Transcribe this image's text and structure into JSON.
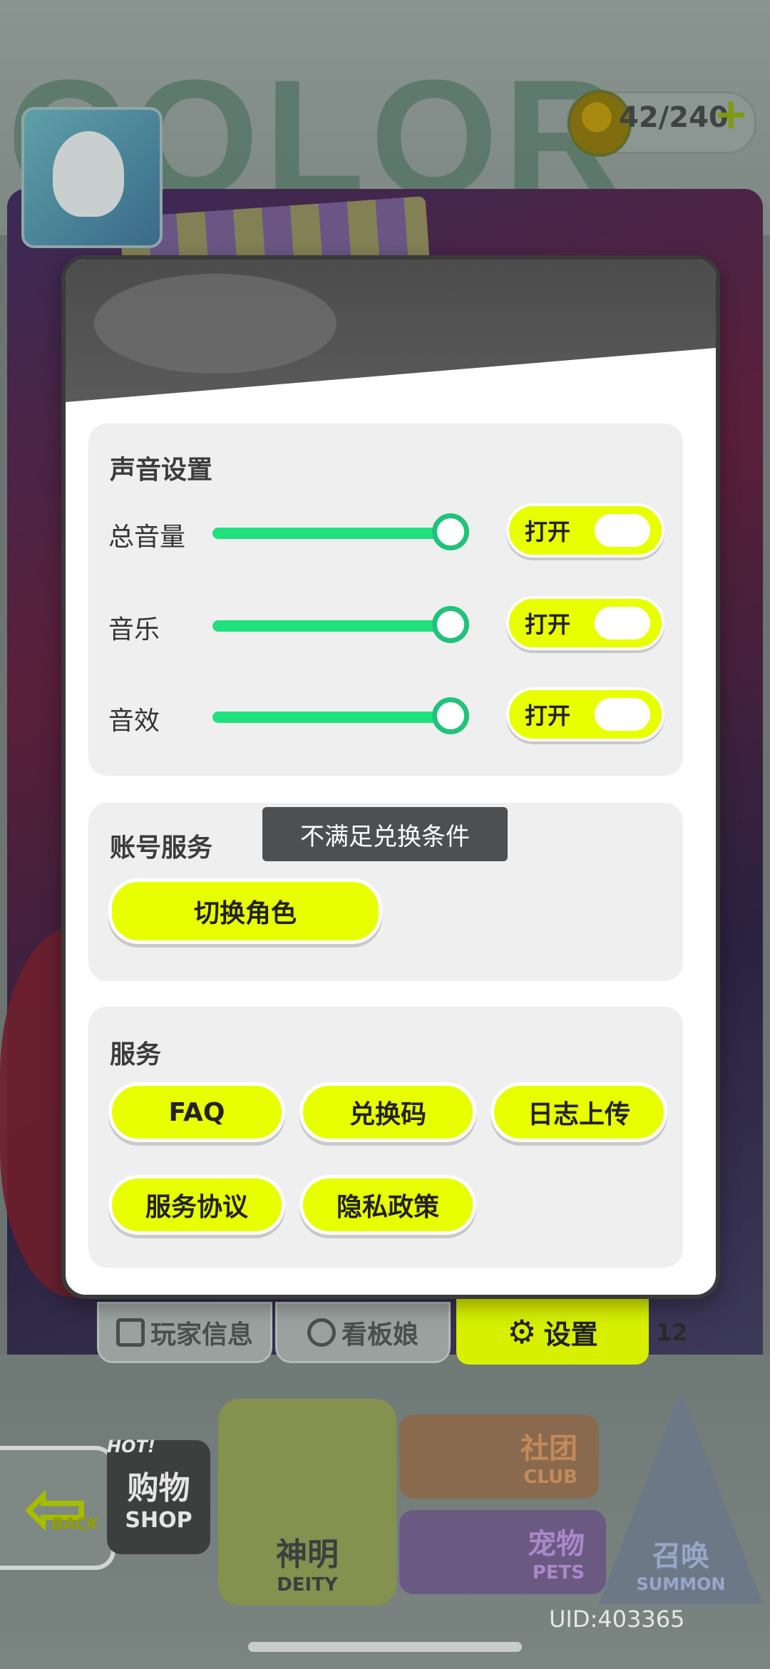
{
  "hud": {
    "currency_value": "42/240",
    "currency_plus": "+"
  },
  "dialog": {
    "sound": {
      "title": "声音设置",
      "rows": [
        {
          "label": "总音量",
          "volume_percent": 100,
          "toggle_label": "打开",
          "toggle_on": true
        },
        {
          "label": "音乐",
          "volume_percent": 100,
          "toggle_label": "打开",
          "toggle_on": true
        },
        {
          "label": "音效",
          "volume_percent": 100,
          "toggle_label": "打开",
          "toggle_on": true
        }
      ]
    },
    "account": {
      "title": "账号服务",
      "tooltip": "不满足兑换条件",
      "switch_role_label": "切换角色"
    },
    "service": {
      "title": "服务",
      "buttons": [
        "FAQ",
        "兑换码",
        "日志上传",
        "服务协议",
        "隐私政策"
      ]
    }
  },
  "tabs": {
    "player_info": "玩家信息",
    "mascot": "看板娘",
    "settings": "设置",
    "side_number": "12"
  },
  "bottom_nav": {
    "back": "BACK",
    "shop_hot": "HOT!",
    "shop_cn": "购物",
    "shop_en": "SHOP",
    "deity_cn": "神明",
    "deity_en": "DEITY",
    "club_cn": "社团",
    "club_en": "CLUB",
    "pets_cn": "宠物",
    "pets_en": "PETS",
    "summon_cn": "召唤",
    "summon_en": "SUMMON"
  },
  "uid": "UID:403365",
  "colors": {
    "accent_yellow": "#e8ff00",
    "slider_green": "#21e07e"
  }
}
